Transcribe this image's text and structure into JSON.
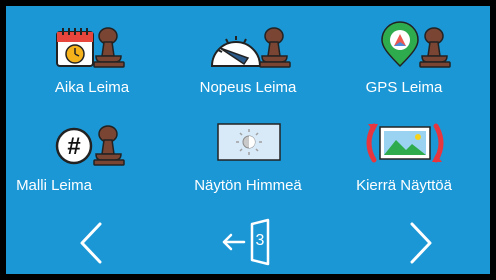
{
  "tiles": [
    {
      "label": "Aika Leima",
      "icon": "calendar-clock-stamp-icon"
    },
    {
      "label": "Nopeus Leima",
      "icon": "speedometer-stamp-icon"
    },
    {
      "label": "GPS Leima",
      "icon": "map-pin-stamp-icon"
    },
    {
      "label": "Malli Leima",
      "icon": "hash-stamp-icon"
    },
    {
      "label": "Näytön Himmeä",
      "icon": "screen-brightness-icon"
    },
    {
      "label": "Kierrä Näyttöä",
      "icon": "rotate-screen-icon"
    }
  ],
  "nav": {
    "page": "3",
    "prev_icon": "chevron-left-icon",
    "next_icon": "chevron-right-icon",
    "exit_icon": "exit-door-icon"
  },
  "colors": {
    "background": "#1b97d6",
    "stamp": "#7a4532",
    "accent_red": "#e8363f"
  }
}
